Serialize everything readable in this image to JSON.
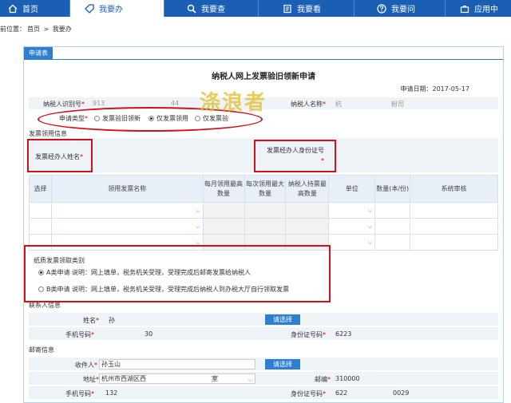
{
  "nav": {
    "tabs": [
      {
        "label": "首页",
        "icon": "home-icon"
      },
      {
        "label": "我要办",
        "icon": "tag-icon"
      },
      {
        "label": "我要查",
        "icon": "search-icon"
      },
      {
        "label": "我要看",
        "icon": "book-icon"
      },
      {
        "label": "我要问",
        "icon": "question-icon"
      },
      {
        "label": "应用中",
        "icon": "briefcase-icon"
      }
    ],
    "active_index": 1
  },
  "breadcrumb": {
    "prefix": "前位置：",
    "home": "首页",
    "sep": ">",
    "current": "我要办"
  },
  "panel_tab": "申请表",
  "form": {
    "title": "纳税人网上发票验旧领新申请",
    "apply_date": "申请日期：2017-05-17",
    "taxpayer_id_label": "纳税人识别号",
    "taxpayer_id_value": "913",
    "taxpayer_id_value2": "44",
    "taxpayer_name_label": "纳税人名称",
    "taxpayer_name_value": "杭",
    "taxpayer_name_value2": "粉司",
    "apply_type_label": "申请类型",
    "apply_type_options": [
      "发票验旧领新",
      "仅发票领用",
      "仅发票验"
    ],
    "apply_type_selected": 1,
    "invoice_section": "发票领用信息",
    "agent_name_label": "发票经办人姓名",
    "agent_id_label": "发票经办人身份证号",
    "table_headers": [
      "选择",
      "领用发票名称",
      "每月领用最高数量",
      "每次领用最大数量",
      "纳税人持票最高数量",
      "单位",
      "数量(本/份)",
      "系统审核"
    ],
    "paper_title": "纸质发票领取类别",
    "paper_options": [
      "A类申请  说明：网上填单，税务机关受理，受理完成后邮寄发票给纳税人",
      "B类申请  说明：网上填单，税务机关受理，受理完成后纳税人到办税大厅自行领取发票"
    ],
    "paper_selected": 0,
    "contact_section": "联系人信息",
    "contact_name_label": "姓名",
    "contact_name_value": "孙",
    "select_btn": "请选择",
    "contact_mobile_label": "手机号码",
    "contact_mobile_value": "30",
    "contact_idno_label": "身份证号码",
    "contact_idno_value": "6223",
    "mail_section": "邮寄信息",
    "recipient_label": "收件人",
    "recipient_value": "孙玉山",
    "address_label": "地址",
    "address_value": "杭州市西湖区西",
    "address_value2": "室",
    "zip_label": "邮编",
    "zip_value": "310000",
    "mail_mobile_label": "手机号码",
    "mail_mobile_value": "132",
    "mail_idno_label": "身份证号码",
    "mail_idno_value": "622",
    "mail_idno_value2": "0029"
  },
  "watermark": "涤浪者",
  "colors": {
    "nav_blue": "#1a5fb4",
    "accent_blue": "#2e7fd0",
    "highlight_red": "#d0101a"
  }
}
